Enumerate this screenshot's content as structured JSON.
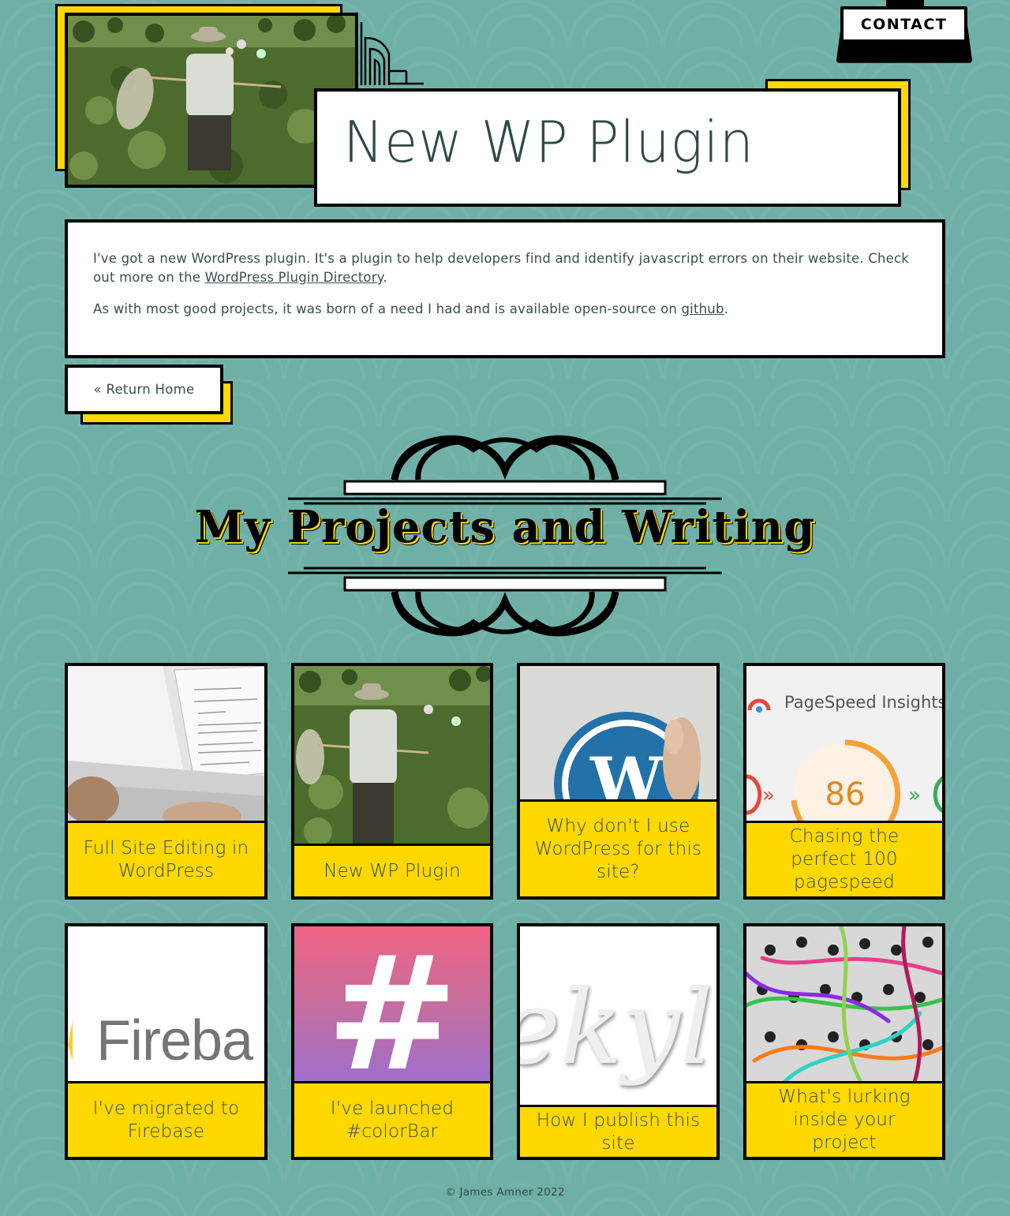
{
  "nav": {
    "contact_label": "CONTACT"
  },
  "post": {
    "title": "New WP Plugin",
    "paragraph1_before_link": "I've got a new WordPress plugin. It's a plugin to help developers find and identify javascript errors on their website. Check out more on the ",
    "paragraph1_link": "WordPress Plugin Directory",
    "paragraph1_after_link": ".",
    "paragraph2_before_link": "As with most good projects, it was born of a need I had and is available open-source on ",
    "paragraph2_link": "github",
    "paragraph2_after_link": "."
  },
  "return_home_label": "« Return Home",
  "projects": {
    "heading": "My Projects and Writing",
    "cards": [
      {
        "title": "Full Site Editing in WordPress",
        "image": "laptop-photo"
      },
      {
        "title": "New WP Plugin",
        "image": "field-net-photo"
      },
      {
        "title": "Why don't I use WordPress for this site?",
        "image": "wordpress-logo-photo"
      },
      {
        "title": "Chasing the perfect 100 pagespeed",
        "image": "pagespeed-screenshot",
        "image_text": "PageSpeed Insights",
        "score": "86"
      },
      {
        "title": "I've migrated to Firebase",
        "image": "firebase-logo",
        "image_text": "Fireba"
      },
      {
        "title": "I've launched #colorBar",
        "image": "hash-gradient",
        "image_text": "#"
      },
      {
        "title": "How I publish this site",
        "image": "jekyll-logo",
        "image_text": "ekyl"
      },
      {
        "title": "What's lurking inside your project",
        "image": "patch-cables-photo"
      }
    ]
  },
  "footer": {
    "copyright": "© James Amner 2022"
  },
  "colors": {
    "background": "#6fb0a6",
    "accent": "#ffd800",
    "border": "#000000",
    "text": "#2f4a45"
  }
}
